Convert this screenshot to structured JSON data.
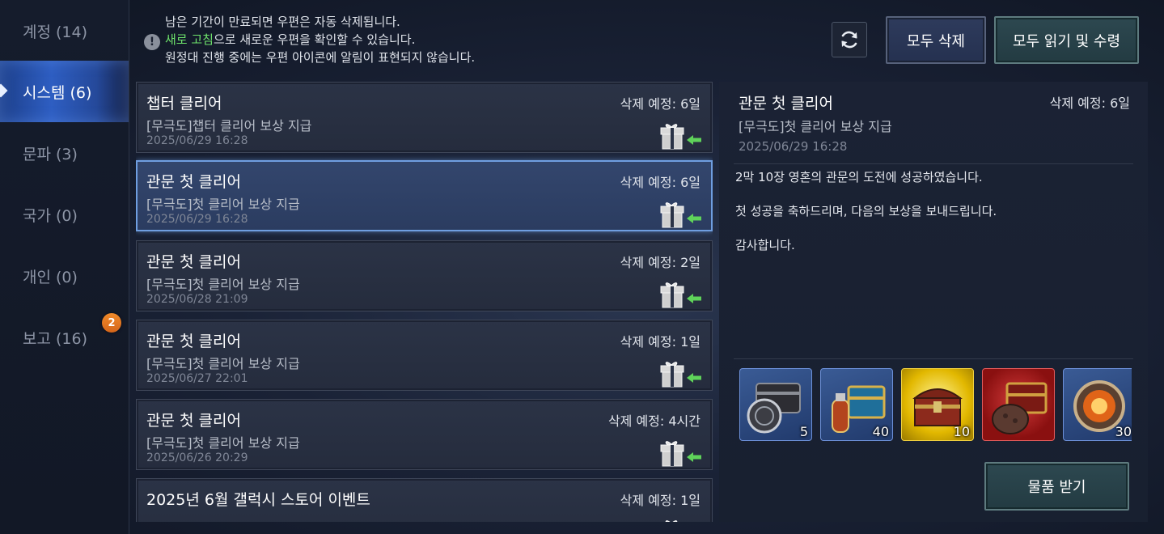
{
  "sidebar": {
    "items": [
      {
        "label": "계정 (14)"
      },
      {
        "label": "시스템 (6)"
      },
      {
        "label": "문파 (3)"
      },
      {
        "label": "국가 (0)"
      },
      {
        "label": "개인 (0)"
      },
      {
        "label": "보고 (16)",
        "badge": "2"
      }
    ]
  },
  "notice": {
    "line1": "남은 기간이 만료되면 우편은 자동 삭제됩니다.",
    "line2_highlight": "새로 고침",
    "line2_rest": "으로 새로운 우편을 확인할 수 있습니다.",
    "line3": "원정대 진행 중에는 우편 아이콘에 알림이 표현되지 않습니다."
  },
  "toolbar": {
    "refresh_icon": "refresh-icon",
    "delete_all_label": "모두 삭제",
    "read_all_label": "모두 읽기 및 수령"
  },
  "mails": [
    {
      "title": "챕터 클리어",
      "sub": "[무극도]챕터 클리어 보상 지급",
      "date": "2025/06/29 16:28",
      "expire": "삭제 예정: 6일"
    },
    {
      "title": "관문 첫 클리어",
      "sub": "[무극도]첫 클리어 보상 지급",
      "date": "2025/06/29 16:28",
      "expire": "삭제 예정: 6일"
    },
    {
      "title": "관문 첫 클리어",
      "sub": "[무극도]첫 클리어 보상 지급",
      "date": "2025/06/28 21:09",
      "expire": "삭제 예정: 2일"
    },
    {
      "title": "관문 첫 클리어",
      "sub": "[무극도]첫 클리어 보상 지급",
      "date": "2025/06/27 22:01",
      "expire": "삭제 예정: 1일"
    },
    {
      "title": "관문 첫 클리어",
      "sub": "[무극도]첫 클리어 보상 지급",
      "date": "2025/06/26 20:29",
      "expire": "삭제 예정: 4시간"
    },
    {
      "title": "2025년 6월 갤럭시 스토어 이벤트",
      "sub": "",
      "date": "",
      "expire": "삭제 예정: 1일"
    }
  ],
  "detail": {
    "title": "관문 첫 클리어",
    "expire": "삭제 예정: 6일",
    "sub": "[무극도]첫 클리어 보상 지급",
    "date": "2025/06/29 16:28",
    "body": [
      "2막 10장 영혼의 관문의 도전에 성공하였습니다.",
      "첫 성공을 축하드리며, 다음의 보상을 보내드립니다.",
      "감사합니다."
    ],
    "rewards": [
      {
        "count": "5",
        "rarity": "blue",
        "icon": "dark-chest-coin-icon"
      },
      {
        "count": "40",
        "rarity": "blue",
        "icon": "blue-chest-potion-icon"
      },
      {
        "count": "10",
        "rarity": "gold",
        "icon": "red-treasure-chest-icon"
      },
      {
        "count": "",
        "rarity": "red",
        "icon": "red-chest-ore-icon"
      },
      {
        "count": "30",
        "rarity": "blue",
        "icon": "fire-orb-icon"
      }
    ],
    "receive_label": "물품 받기"
  },
  "colors": {
    "active_tab": "#2e5ec2",
    "highlight_green": "#6ee26b",
    "badge_orange": "#f08a2a",
    "gift_arrow": "#5fd35a"
  }
}
